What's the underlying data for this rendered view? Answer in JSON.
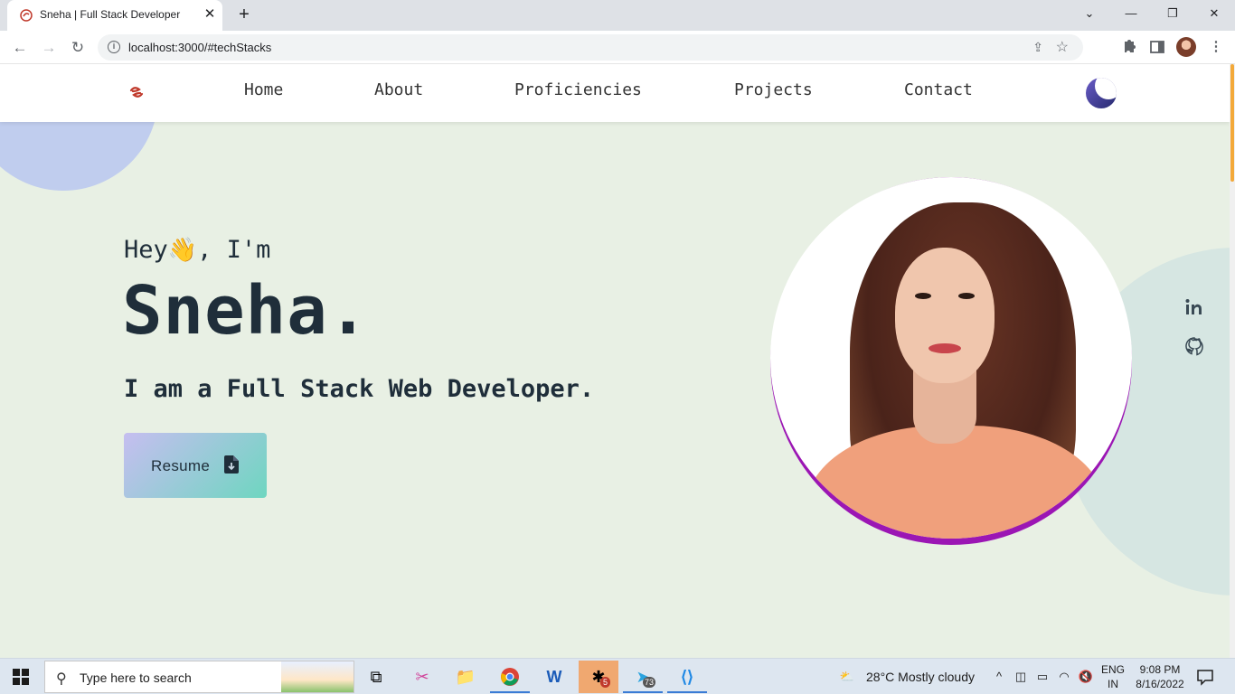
{
  "browser": {
    "tab_title": "Sneha | Full Stack Developer",
    "tab_close": "✕",
    "new_tab": "+",
    "url": "localhost:3000/#techStacks",
    "window_controls": {
      "chevron": "⌄",
      "minimize": "—",
      "restore": "❐",
      "close": "✕"
    }
  },
  "site": {
    "nav": {
      "links": [
        {
          "label": "Home"
        },
        {
          "label": "About"
        },
        {
          "label": "Proficiencies"
        },
        {
          "label": "Projects"
        },
        {
          "label": "Contact"
        }
      ],
      "theme_toggle_icon": "moon-icon"
    },
    "hero": {
      "greeting_start": "Hey",
      "wave_emoji": "👋",
      "greeting_end": ", I'm",
      "name": "Sneha.",
      "role": "I am a Full Stack Web Developer.",
      "resume_button": "Resume"
    },
    "social": [
      "linkedin-icon",
      "github-icon"
    ],
    "colors": {
      "accent_gradient_start": "#c6bef0",
      "accent_gradient_end": "#6ed6c0",
      "portrait_ring": "#9b16b4",
      "text": "#1f2e3a",
      "page_bg": "#e8f0e4"
    }
  },
  "taskbar": {
    "search_placeholder": "Type here to search",
    "weather": "28°C  Mostly cloudy",
    "lang_line1": "ENG",
    "lang_line2": "IN",
    "time": "9:08 PM",
    "date": "8/16/2022",
    "slack_badge": "5",
    "telegram_badge": "73"
  }
}
